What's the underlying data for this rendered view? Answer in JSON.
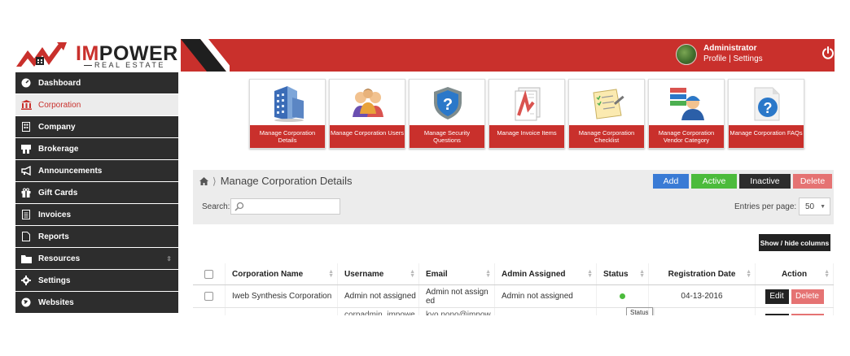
{
  "brand": {
    "name_im": "IM",
    "name_power": "POWER",
    "sub": "REAL ESTATE"
  },
  "header": {
    "user_name": "Administrator",
    "user_links": "Profile | Settings"
  },
  "sidebar": {
    "items": [
      {
        "label": "Dashboard",
        "icon": "dashboard-icon"
      },
      {
        "label": "Corporation",
        "icon": "bank-icon"
      },
      {
        "label": "Company",
        "icon": "building-icon"
      },
      {
        "label": "Brokerage",
        "icon": "brokerage-icon"
      },
      {
        "label": "Announcements",
        "icon": "megaphone-icon"
      },
      {
        "label": "Gift Cards",
        "icon": "gift-icon"
      },
      {
        "label": "Invoices",
        "icon": "invoice-icon"
      },
      {
        "label": "Reports",
        "icon": "file-icon"
      },
      {
        "label": "Resources",
        "icon": "folder-icon"
      },
      {
        "label": "Settings",
        "icon": "gear-icon"
      },
      {
        "label": "Websites",
        "icon": "globe-icon"
      }
    ]
  },
  "tiles": [
    {
      "label": "Manage Corporation Details"
    },
    {
      "label": "Manage Corporation Users"
    },
    {
      "label": "Manage Security Questions"
    },
    {
      "label": "Manage Invoice Items"
    },
    {
      "label": "Manage Corporation Checklist"
    },
    {
      "label": "Manage Corporation Vendor Category"
    },
    {
      "label": "Manage Corporation FAQs"
    }
  ],
  "panel": {
    "title": "Manage Corporation Details",
    "buttons": {
      "add": "Add",
      "active": "Active",
      "inactive": "Inactive",
      "delete": "Delete"
    },
    "search_label": "Search:",
    "entries_label": "Entries per page:",
    "entries_value": "50",
    "show_hide": "Show / hide columns"
  },
  "table": {
    "columns": [
      "Corporation Name",
      "Username",
      "Email",
      "Admin Assigned",
      "Status",
      "Registration Date",
      "Action"
    ],
    "rows": [
      {
        "corporation_name": "Iweb Synthesis Corporation",
        "username": "Admin not assigned",
        "email": "Admin not assign ed",
        "admin_assigned": "Admin not assigned",
        "status": "active",
        "registration_date": "04-13-2016",
        "edit": "Edit",
        "delete": "Delete"
      },
      {
        "username": "corpadmin_impowe",
        "email": "kyo nono@impow"
      }
    ],
    "tooltip": "Status"
  }
}
